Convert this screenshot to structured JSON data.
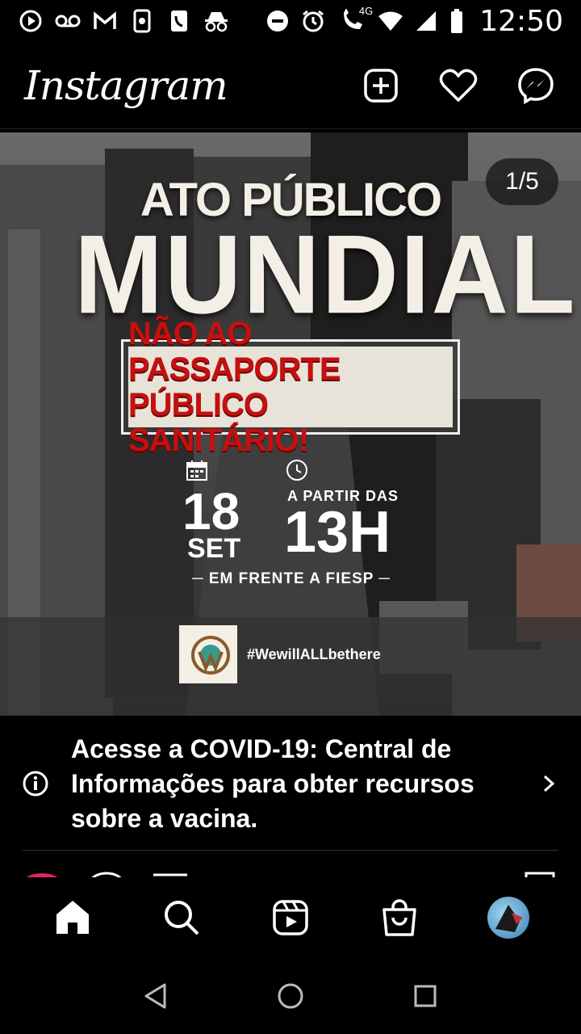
{
  "status_bar": {
    "time": "12:50",
    "network": "4G",
    "icons": [
      "media-icon",
      "voicemail-icon",
      "gmail-icon",
      "phone-sync-icon",
      "call-icon",
      "incognito-icon",
      "dnd-icon",
      "alarm-icon",
      "wifi-call-icon",
      "wifi-icon",
      "signal-icon",
      "battery-icon"
    ]
  },
  "header": {
    "logo": "Instagram",
    "actions": [
      "new-post-icon",
      "heart-icon",
      "messenger-icon"
    ]
  },
  "post": {
    "counter": "1/5",
    "title_line1": "ATO PÚBLICO",
    "title_line2": "MUNDIAL",
    "banner_line1": "NÃO AO PASSAPORTE",
    "banner_line2": "PÚBLICO SANITÁRIO!",
    "day": "18",
    "month": "SET",
    "from_label": "A PARTIR DAS",
    "hour": "13H",
    "place": "─ EM FRENTE A FIESP ─",
    "hashtag": "#WewillALLbethere",
    "logo_text": "WORLD WIDE RALLY"
  },
  "covid_banner": {
    "text": "Acesse a COVID-19: Central de Informações para obter recursos sobre a vacina."
  },
  "bottom_nav": {
    "items": [
      "home-icon",
      "search-icon",
      "reels-icon",
      "shop-icon",
      "profile-avatar"
    ]
  },
  "colors": {
    "accent_red": "#c41010",
    "bg": "#000000",
    "text": "#ffffff"
  }
}
